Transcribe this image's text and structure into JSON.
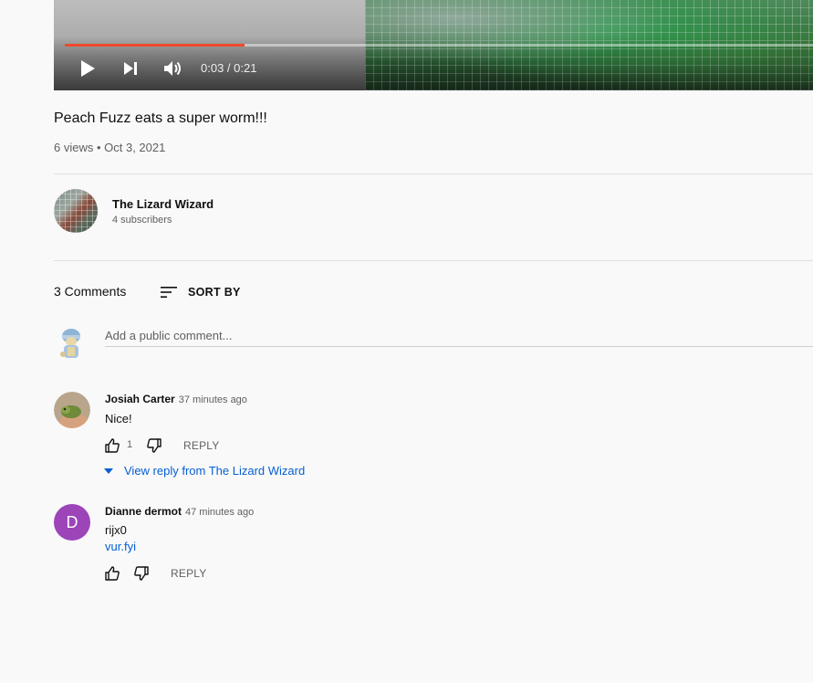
{
  "player": {
    "time_display": "0:03 / 0:21",
    "progress_fraction": 0.24,
    "accent_color": "#ee4b2b",
    "controls": [
      "play-icon",
      "next-icon",
      "volume-icon"
    ]
  },
  "video": {
    "title": "Peach Fuzz eats a super worm!!!",
    "meta": "6 views • Oct 3, 2021"
  },
  "channel": {
    "name": "The Lizard Wizard",
    "subscribers": "4 subscribers"
  },
  "comments_section": {
    "count_label": "3 Comments",
    "sort_label": "SORT BY",
    "input_placeholder": "Add a public comment...",
    "link_color": "#065fd4"
  },
  "comments": [
    {
      "author": "Josiah Carter",
      "time": "37 minutes ago",
      "text": "Nice!",
      "likes": "1",
      "reply_label": "REPLY",
      "view_replies_label": "View reply from The Lizard Wizard"
    },
    {
      "author": "Dianne dermot",
      "avatar_letter": "D",
      "avatar_color": "#9c44b8",
      "time": "47 minutes ago",
      "text": "rijx0",
      "link": "vur.fyi",
      "reply_label": "REPLY"
    }
  ]
}
